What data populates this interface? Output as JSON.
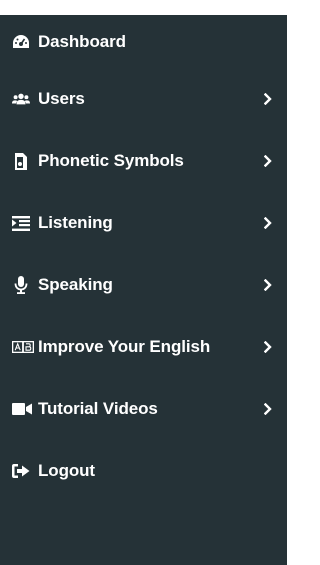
{
  "sidebar": {
    "items": [
      {
        "label": "Dashboard",
        "icon": "dashboard-gauge-icon",
        "has_submenu": false
      },
      {
        "label": "Users",
        "icon": "users-icon",
        "has_submenu": true
      },
      {
        "label": "Phonetic Symbols",
        "icon": "document-icon",
        "has_submenu": true
      },
      {
        "label": "Listening",
        "icon": "listening-list-icon",
        "has_submenu": true
      },
      {
        "label": "Speaking",
        "icon": "microphone-icon",
        "has_submenu": true
      },
      {
        "label": "Improve Your English",
        "icon": "ab-language-icon",
        "has_submenu": true
      },
      {
        "label": "Tutorial Videos",
        "icon": "video-camera-icon",
        "has_submenu": true
      },
      {
        "label": "Logout",
        "icon": "logout-icon",
        "has_submenu": false
      }
    ]
  },
  "colors": {
    "sidebar_bg": "#253237",
    "text": "#ffffff"
  }
}
